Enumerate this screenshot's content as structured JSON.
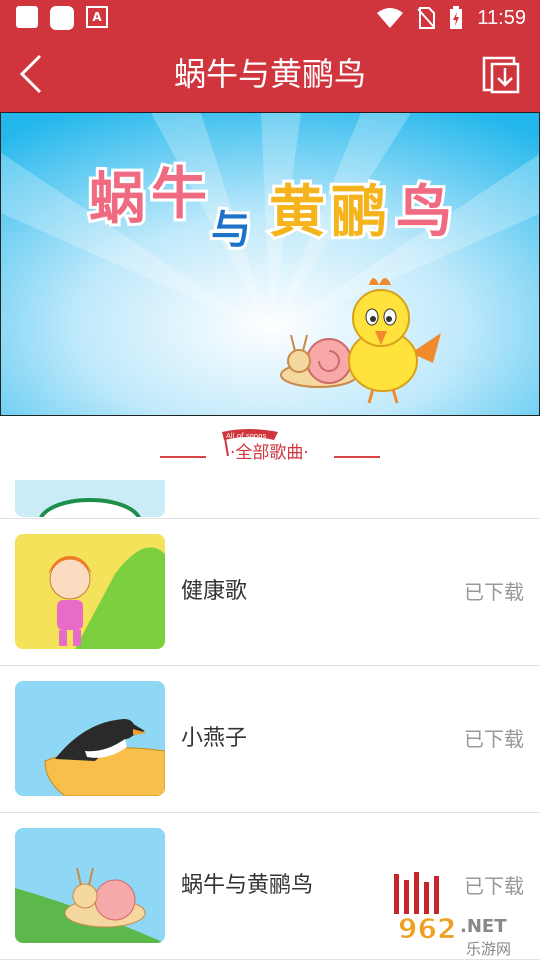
{
  "status_bar": {
    "time": "11:59"
  },
  "app_bar": {
    "title": "蜗牛与黄鹂鸟"
  },
  "banner": {
    "title_chars": [
      "蜗",
      "牛",
      "与",
      "黄",
      "鹂",
      "鸟"
    ]
  },
  "section": {
    "badge": "All of songs",
    "label": "·全部歌曲·"
  },
  "songs": [
    {
      "name": "健康歌",
      "status": "已下载"
    },
    {
      "name": "小燕子",
      "status": "已下载"
    },
    {
      "name": "蜗牛与黄鹂鸟",
      "status": "已下载"
    }
  ],
  "watermark": {
    "number": "962",
    "domain": ".NET",
    "subtitle": "乐游网"
  },
  "colors": {
    "primary": "#d0343c",
    "muted": "#999999"
  }
}
